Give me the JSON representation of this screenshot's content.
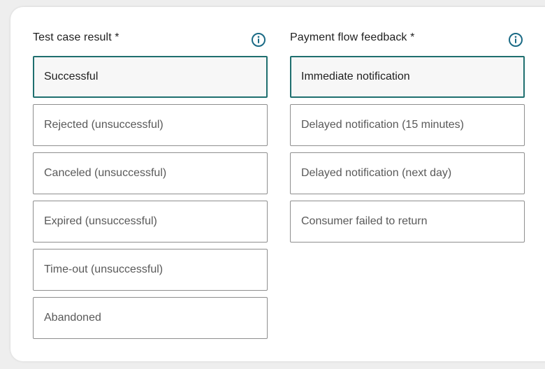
{
  "test_case": {
    "title": "Test case result *",
    "info_icon": "info-icon",
    "selected_index": 0,
    "options": [
      {
        "label": "Successful"
      },
      {
        "label": "Rejected (unsuccessful)"
      },
      {
        "label": "Canceled (unsuccessful)"
      },
      {
        "label": "Expired (unsuccessful)"
      },
      {
        "label": "Time-out (unsuccessful)"
      },
      {
        "label": "Abandoned"
      }
    ]
  },
  "payment_flow": {
    "title": "Payment flow feedback *",
    "info_icon": "info-icon",
    "selected_index": 0,
    "options": [
      {
        "label": "Immediate notification"
      },
      {
        "label": "Delayed notification (15 minutes)"
      },
      {
        "label": "Delayed notification (next day)"
      },
      {
        "label": "Consumer failed to return"
      }
    ]
  },
  "colors": {
    "accent": "#1f6f6f",
    "icon": "#1a6a85",
    "border": "#8e8e8e",
    "text": "#1f1f1f",
    "muted_text": "#595959"
  }
}
